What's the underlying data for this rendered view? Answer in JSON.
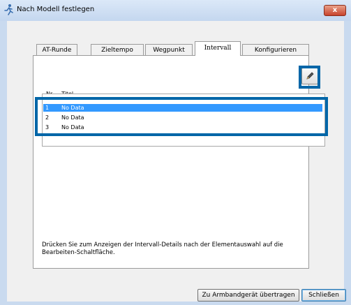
{
  "window": {
    "title": "Nach Modell festlegen",
    "close_label": "x"
  },
  "tabs": [
    {
      "label": "AT-Runde",
      "active": false
    },
    {
      "label": "Zieltempo",
      "active": false
    },
    {
      "label": "Wegpunkt",
      "active": false
    },
    {
      "label": "Intervall",
      "active": true
    },
    {
      "label": "Konfigurieren",
      "active": false
    }
  ],
  "list": {
    "columns": [
      "Nr.",
      "Titel"
    ],
    "rows": [
      {
        "num": "1",
        "title": "No Data",
        "selected": true
      },
      {
        "num": "2",
        "title": "No Data",
        "selected": false
      },
      {
        "num": "3",
        "title": "No Data",
        "selected": false
      }
    ]
  },
  "edit_button": {
    "icon": "pencil-icon"
  },
  "hint": "Drücken Sie zum Anzeigen der Intervall-Details nach der Elementauswahl auf die Bearbeiten-Schaltfläche.",
  "buttons": {
    "transfer_label": "Zu Armbandgerät übertragen",
    "close_label": "Schließen"
  },
  "colors": {
    "highlight": "#0066a8",
    "selection": "#3399ff"
  }
}
